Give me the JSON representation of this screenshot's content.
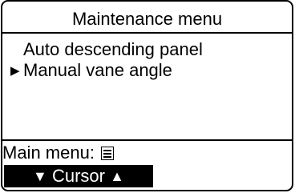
{
  "header": {
    "title": "Maintenance menu"
  },
  "menu": {
    "items": [
      {
        "label": "Auto descending panel",
        "selected": false
      },
      {
        "label": "Manual vane angle",
        "selected": true
      }
    ],
    "selection_marker": "▶"
  },
  "footer": {
    "main_menu_label": "Main menu:",
    "main_menu_icon": "menu-list-icon",
    "cursor": {
      "down_glyph": "▼",
      "label": "Cursor",
      "up_glyph": "▲"
    }
  }
}
